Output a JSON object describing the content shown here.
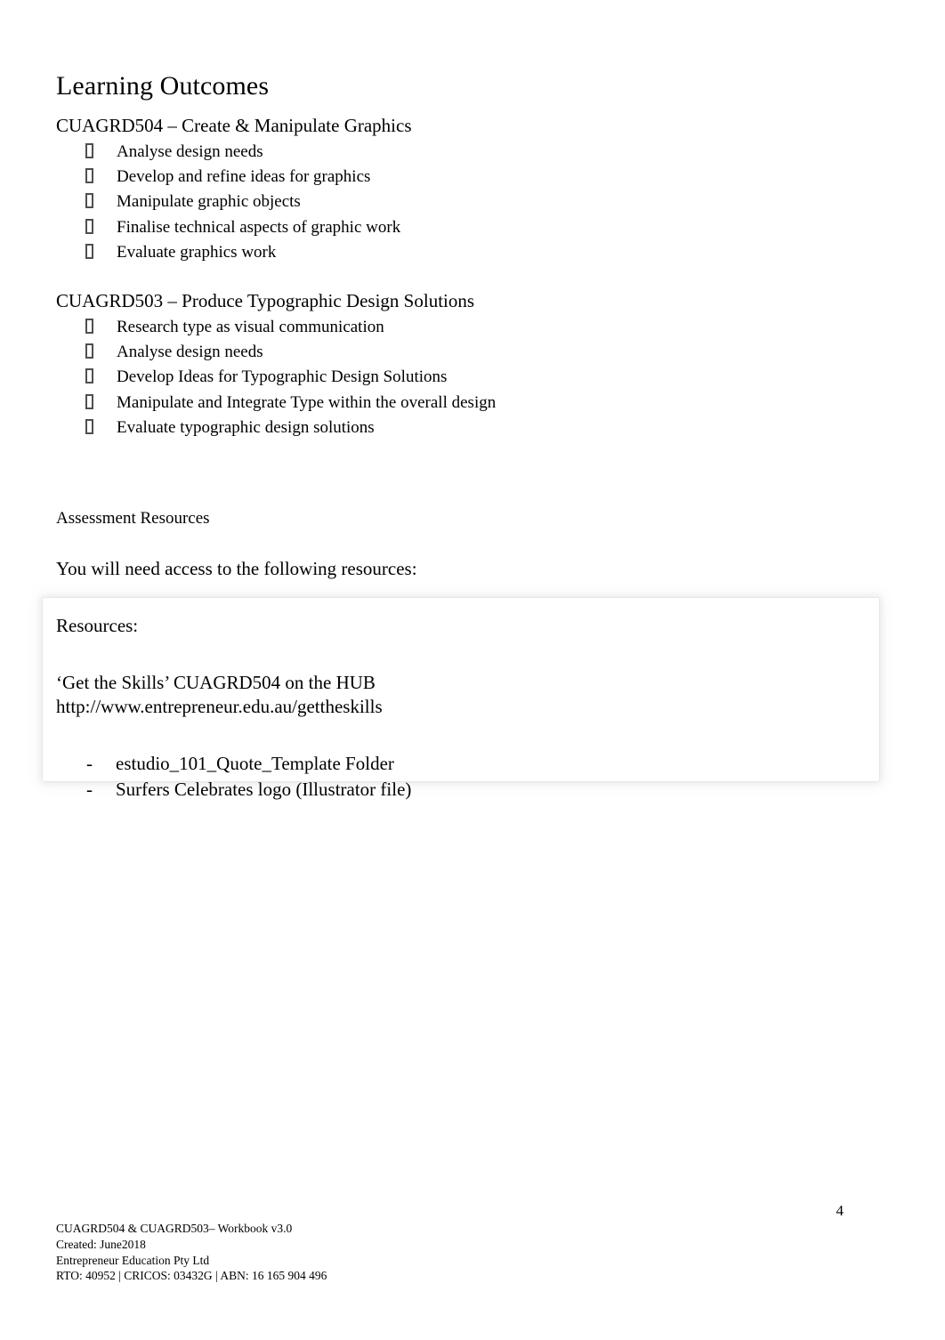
{
  "document": {
    "title": "Learning Outcomes",
    "page_number": "4"
  },
  "outcome_groups": [
    {
      "heading": "CUAGRD504 – Create & Manipulate Graphics",
      "items": [
        "Analyse design needs",
        "Develop and refine ideas for graphics",
        "Manipulate graphic objects",
        "Finalise technical aspects of graphic work",
        "Evaluate graphics work"
      ]
    },
    {
      "heading": "CUAGRD503 – Produce Typographic Design Solutions",
      "items": [
        "Research type as visual communication",
        "Analyse design needs",
        "Develop Ideas for Typographic Design Solutions",
        "Manipulate and Integrate Type within the overall design",
        "Evaluate typographic design solutions"
      ]
    }
  ],
  "assessment": {
    "section_label": "Assessment Resources",
    "intro": "You will need access to the following resources:"
  },
  "resource_box": {
    "title": "Resources:",
    "hub_line": "‘Get the Skills’ CUAGRD504 on the HUB",
    "url": "http://www.entrepreneur.edu.au/gettheskills",
    "dash_mark": "-",
    "items": [
      "estudio_101_Quote_Template Folder",
      "Surfers Celebrates logo (Illustrator file)"
    ]
  },
  "footer": {
    "line1": "CUAGRD504 & CUAGRD503– Workbook v3.0",
    "line2": "Created: June2018",
    "line3": "Entrepreneur Education Pty Ltd",
    "line4": "RTO: 40952 | CRICOS: 03432G | ABN: 16 165 904 496"
  }
}
